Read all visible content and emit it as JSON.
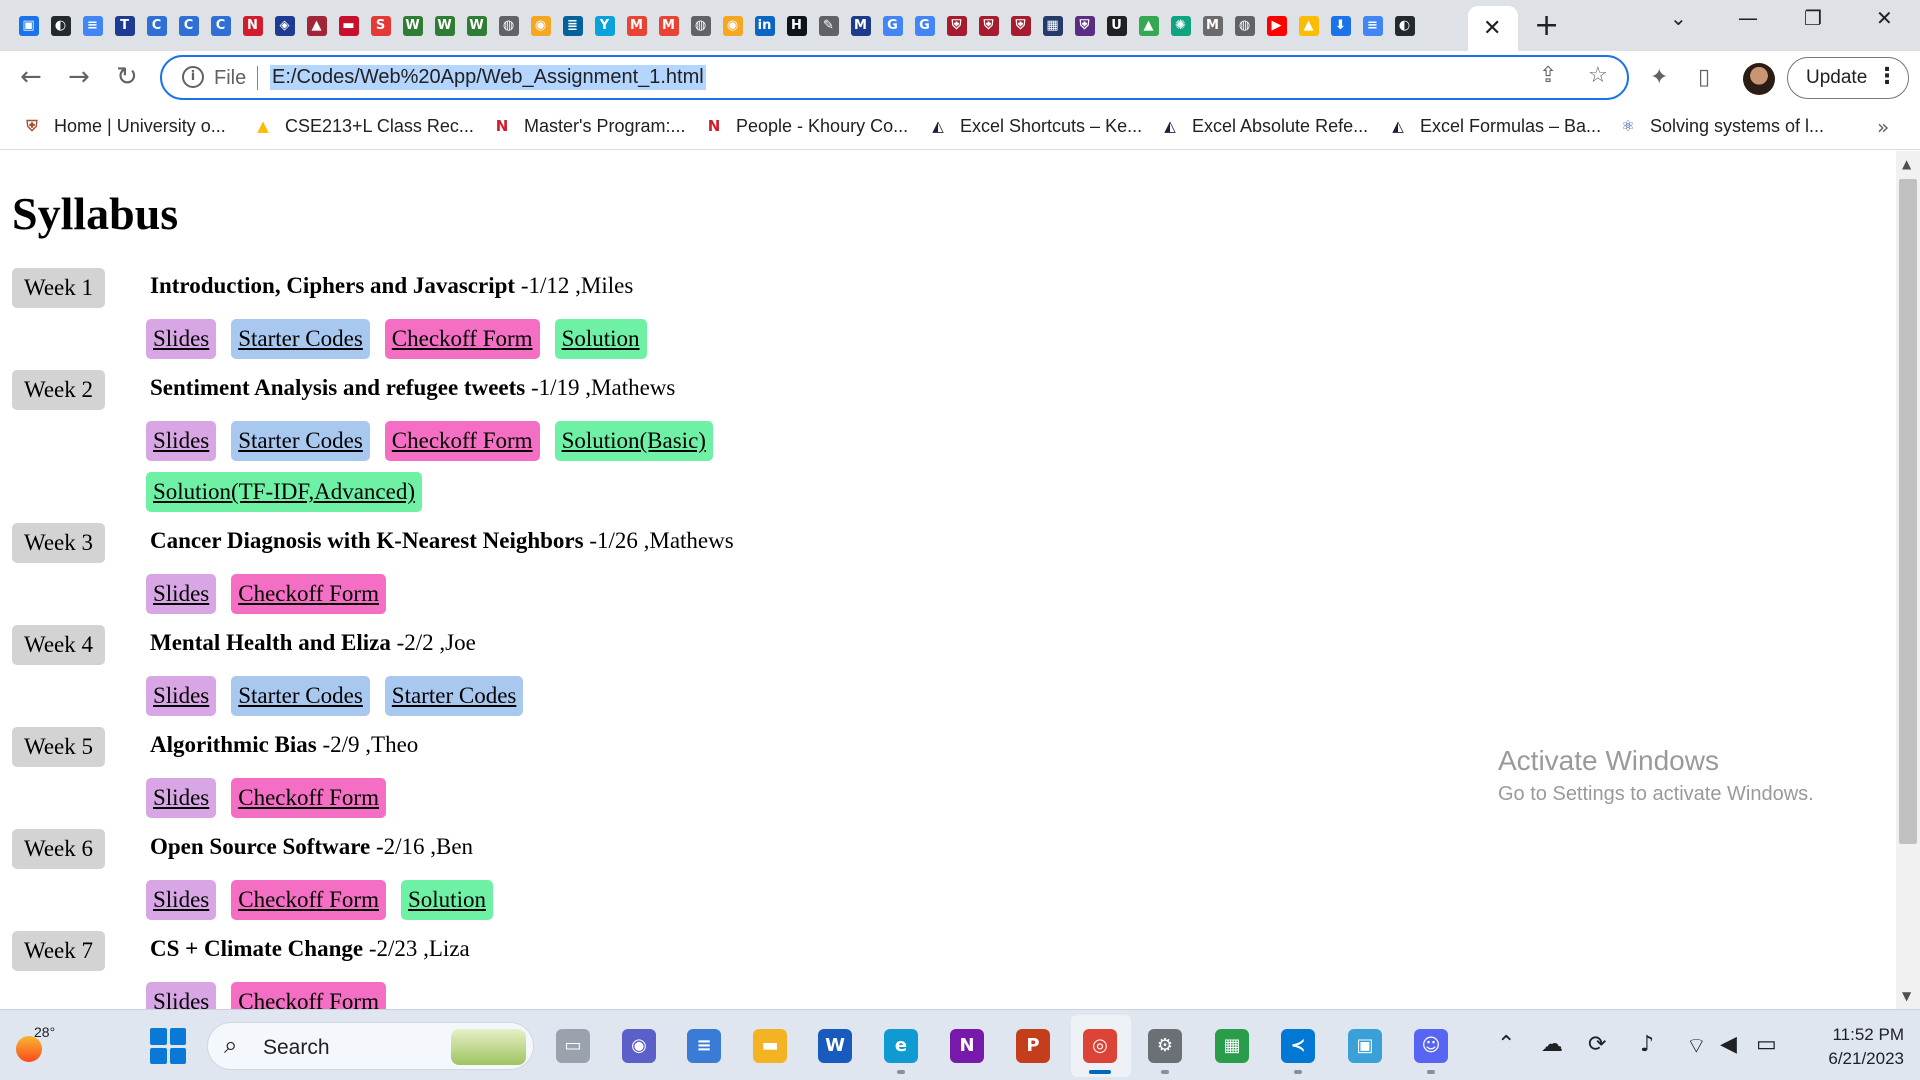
{
  "browser": {
    "tab_favicons": [
      {
        "icon": "profile-card-icon",
        "color": "#1a73e8",
        "glyph": "▣"
      },
      {
        "icon": "github-icon",
        "color": "#24292f",
        "glyph": "◐"
      },
      {
        "icon": "docs-icon",
        "color": "#4285f4",
        "glyph": "≡"
      },
      {
        "icon": "t-icon",
        "color": "#1f3a93",
        "glyph": "T"
      },
      {
        "icon": "c-icon",
        "color": "#2f6fd6",
        "glyph": "C"
      },
      {
        "icon": "c-icon",
        "color": "#2f6fd6",
        "glyph": "C"
      },
      {
        "icon": "c-icon",
        "color": "#2f6fd6",
        "glyph": "C"
      },
      {
        "icon": "northeastern-icon",
        "color": "#d41b2c",
        "glyph": "N"
      },
      {
        "icon": "shield-icon",
        "color": "#1f3a93",
        "glyph": "◈"
      },
      {
        "icon": "stevens-icon",
        "color": "#a32638",
        "glyph": "▲"
      },
      {
        "icon": "red-icon",
        "color": "#c8102e",
        "glyph": "▬"
      },
      {
        "icon": "swirl-icon",
        "color": "#e53935",
        "glyph": "S"
      },
      {
        "icon": "w-icon",
        "color": "#2e7d32",
        "glyph": "W"
      },
      {
        "icon": "w-icon",
        "color": "#2e7d32",
        "glyph": "W"
      },
      {
        "icon": "w-icon",
        "color": "#2e7d32",
        "glyph": "W"
      },
      {
        "icon": "globe-icon",
        "color": "#5f6368",
        "glyph": "◍"
      },
      {
        "icon": "orange-icon",
        "color": "#f5a623",
        "glyph": "◉"
      },
      {
        "icon": "ieee-icon",
        "color": "#00629b",
        "glyph": "≣"
      },
      {
        "icon": "y-icon",
        "color": "#0aa1dd",
        "glyph": "Y"
      },
      {
        "icon": "gmail-icon",
        "color": "#ea4335",
        "glyph": "M"
      },
      {
        "icon": "gmail-icon",
        "color": "#ea4335",
        "glyph": "M"
      },
      {
        "icon": "globe-icon",
        "color": "#5f6368",
        "glyph": "◍"
      },
      {
        "icon": "orange-icon",
        "color": "#f5a623",
        "glyph": "◉"
      },
      {
        "icon": "linkedin-icon",
        "color": "#0a66c2",
        "glyph": "in"
      },
      {
        "icon": "hackerrank-icon",
        "color": "#0e141e",
        "glyph": "H"
      },
      {
        "icon": "tool-icon",
        "color": "#5f6368",
        "glyph": "✎"
      },
      {
        "icon": "m-icon",
        "color": "#1e3a8a",
        "glyph": "M"
      },
      {
        "icon": "google-icon",
        "color": "#4285f4",
        "glyph": "G"
      },
      {
        "icon": "google-icon",
        "color": "#4285f4",
        "glyph": "G"
      },
      {
        "icon": "harvard-icon",
        "color": "#a51c30",
        "glyph": "⛨"
      },
      {
        "icon": "harvard-icon",
        "color": "#a51c30",
        "glyph": "⛨"
      },
      {
        "icon": "harvard-icon",
        "color": "#a51c30",
        "glyph": "⛨"
      },
      {
        "icon": "pattern-icon",
        "color": "#243b6b",
        "glyph": "▦"
      },
      {
        "icon": "crest-icon",
        "color": "#5b2c83",
        "glyph": "⛨"
      },
      {
        "icon": "ug-icon",
        "color": "#202124",
        "glyph": "U"
      },
      {
        "icon": "drive-icon",
        "color": "#34a853",
        "glyph": "▲"
      },
      {
        "icon": "chatgpt-icon",
        "color": "#10a37f",
        "glyph": "✺"
      },
      {
        "icon": "medium-icon",
        "color": "#6b6b6b",
        "glyph": "M"
      },
      {
        "icon": "globe-icon",
        "color": "#5f6368",
        "glyph": "◍"
      },
      {
        "icon": "youtube-icon",
        "color": "#ff0000",
        "glyph": "▶"
      },
      {
        "icon": "drive-icon",
        "color": "#fbbc04",
        "glyph": "▲"
      },
      {
        "icon": "download-icon",
        "color": "#1a73e8",
        "glyph": "⬇"
      },
      {
        "icon": "docs-icon",
        "color": "#4285f4",
        "glyph": "≡"
      },
      {
        "icon": "github-icon",
        "color": "#24292f",
        "glyph": "◐"
      }
    ],
    "tab_close": "✕",
    "new_tab": "+",
    "url_prefix": "File",
    "url": "E:/Codes/Web%20App/Web_Assignment_1.html",
    "update_label": "Update",
    "bookmarks": [
      {
        "label": "Home | University o...",
        "icon": "university-crest-icon",
        "color": "#a0522d",
        "glyph": "⛨"
      },
      {
        "label": "CSE213+L Class Rec...",
        "icon": "google-drive-icon",
        "color": "#fbbc04",
        "glyph": "▲"
      },
      {
        "label": "Master's Program:...",
        "icon": "northeastern-icon",
        "color": "#d41b2c",
        "glyph": "N"
      },
      {
        "label": "People - Khoury Co...",
        "icon": "northeastern-icon",
        "color": "#d41b2c",
        "glyph": "N"
      },
      {
        "label": "Excel Shortcuts – Ke...",
        "icon": "excel-jet-icon",
        "color": "#1f1f3d",
        "glyph": "◭"
      },
      {
        "label": "Excel Absolute Refe...",
        "icon": "excel-jet-icon",
        "color": "#1f1f3d",
        "glyph": "◭"
      },
      {
        "label": "Excel Formulas – Ba...",
        "icon": "excel-jet-icon",
        "color": "#1f1f3d",
        "glyph": "◭"
      },
      {
        "label": "Solving systems of l...",
        "icon": "atom-icon",
        "color": "#3f51b5",
        "glyph": "⚛"
      }
    ]
  },
  "syllabus": {
    "title": "Syllabus",
    "weeks": [
      {
        "label": "Week 1",
        "topic": "Introduction, Ciphers and Javascript",
        "meta": " -1/12 ,Miles",
        "buttons": [
          {
            "label": "Slides",
            "kind": "slides"
          },
          {
            "label": "Starter Codes",
            "kind": "starter"
          },
          {
            "label": "Checkoff Form",
            "kind": "checkoff"
          },
          {
            "label": "Solution",
            "kind": "solution"
          }
        ]
      },
      {
        "label": "Week 2",
        "topic": "Sentiment Analysis and refugee tweets",
        "meta": " -1/19 ,Mathews",
        "buttons": [
          {
            "label": "Slides",
            "kind": "slides"
          },
          {
            "label": "Starter Codes",
            "kind": "starter"
          },
          {
            "label": "Checkoff Form",
            "kind": "checkoff"
          },
          {
            "label": "Solution(Basic)",
            "kind": "solution"
          }
        ],
        "extra_buttons": [
          {
            "label": "Solution(TF-IDF,Advanced)",
            "kind": "solution"
          }
        ]
      },
      {
        "label": "Week 3",
        "topic": "Cancer Diagnosis with K-Nearest Neighbors",
        "meta": " -1/26 ,Mathews",
        "buttons": [
          {
            "label": "Slides",
            "kind": "slides"
          },
          {
            "label": "Checkoff Form",
            "kind": "checkoff"
          }
        ]
      },
      {
        "label": "Week 4",
        "topic": "Mental Health and Eliza",
        "meta": " -2/2 ,Joe",
        "buttons": [
          {
            "label": "Slides",
            "kind": "slides"
          },
          {
            "label": "Starter Codes",
            "kind": "starter"
          },
          {
            "label": "Starter Codes",
            "kind": "starter"
          }
        ]
      },
      {
        "label": "Week 5",
        "topic": "Algorithmic Bias",
        "meta": " -2/9 ,Theo",
        "buttons": [
          {
            "label": "Slides",
            "kind": "slides"
          },
          {
            "label": "Checkoff Form",
            "kind": "checkoff"
          }
        ]
      },
      {
        "label": "Week 6",
        "topic": "Open Source Software",
        "meta": " -2/16 ,Ben",
        "buttons": [
          {
            "label": "Slides",
            "kind": "slides"
          },
          {
            "label": "Checkoff Form",
            "kind": "checkoff"
          },
          {
            "label": "Solution",
            "kind": "solution"
          }
        ]
      },
      {
        "label": "Week 7",
        "topic": "CS + Climate Change",
        "meta": " -2/23 ,Liza",
        "buttons": [
          {
            "label": "Slides",
            "kind": "slides"
          },
          {
            "label": "Checkoff Form",
            "kind": "checkoff"
          }
        ]
      }
    ]
  },
  "watermark": {
    "line1": "Activate Windows",
    "line2": "Go to Settings to activate Windows."
  },
  "taskbar": {
    "temperature": "28°",
    "search_label": "Search",
    "apps": [
      {
        "name": "taskbar-desktop",
        "icon": "desktop-icon",
        "color": "#9aa3ad",
        "glyph": "▭"
      },
      {
        "name": "taskbar-teams-chat",
        "icon": "chat-icon",
        "color": "#5b5fc7",
        "glyph": "◉"
      },
      {
        "name": "taskbar-notepad",
        "icon": "notepad-icon",
        "color": "#3a7bd5",
        "glyph": "≡"
      },
      {
        "name": "taskbar-file-explorer",
        "icon": "folder-icon",
        "color": "#f3b322",
        "glyph": "▬"
      },
      {
        "name": "taskbar-word",
        "icon": "word-icon",
        "color": "#185abd",
        "glyph": "W"
      },
      {
        "name": "taskbar-edge",
        "icon": "edge-icon",
        "color": "#0f9ad1",
        "glyph": "e"
      },
      {
        "name": "taskbar-onenote",
        "icon": "onenote-icon",
        "color": "#7719aa",
        "glyph": "N"
      },
      {
        "name": "taskbar-powerpoint",
        "icon": "powerpoint-icon",
        "color": "#c43e1c",
        "glyph": "P"
      },
      {
        "name": "taskbar-chrome",
        "icon": "chrome-icon",
        "color": "#db4437",
        "glyph": "◎"
      },
      {
        "name": "taskbar-settings",
        "icon": "gear-icon",
        "color": "#6b6f76",
        "glyph": "⚙"
      },
      {
        "name": "taskbar-store",
        "icon": "store-icon",
        "color": "#2a9d4b",
        "glyph": "▦"
      },
      {
        "name": "taskbar-vscode",
        "icon": "vscode-icon",
        "color": "#0078d4",
        "glyph": "≺"
      },
      {
        "name": "taskbar-app",
        "icon": "window-app-icon",
        "color": "#3aa0d8",
        "glyph": "▣"
      },
      {
        "name": "taskbar-discord",
        "icon": "discord-icon",
        "color": "#5865f2",
        "glyph": "☺"
      }
    ],
    "time": "11:52 PM",
    "date": "6/21/2023"
  }
}
